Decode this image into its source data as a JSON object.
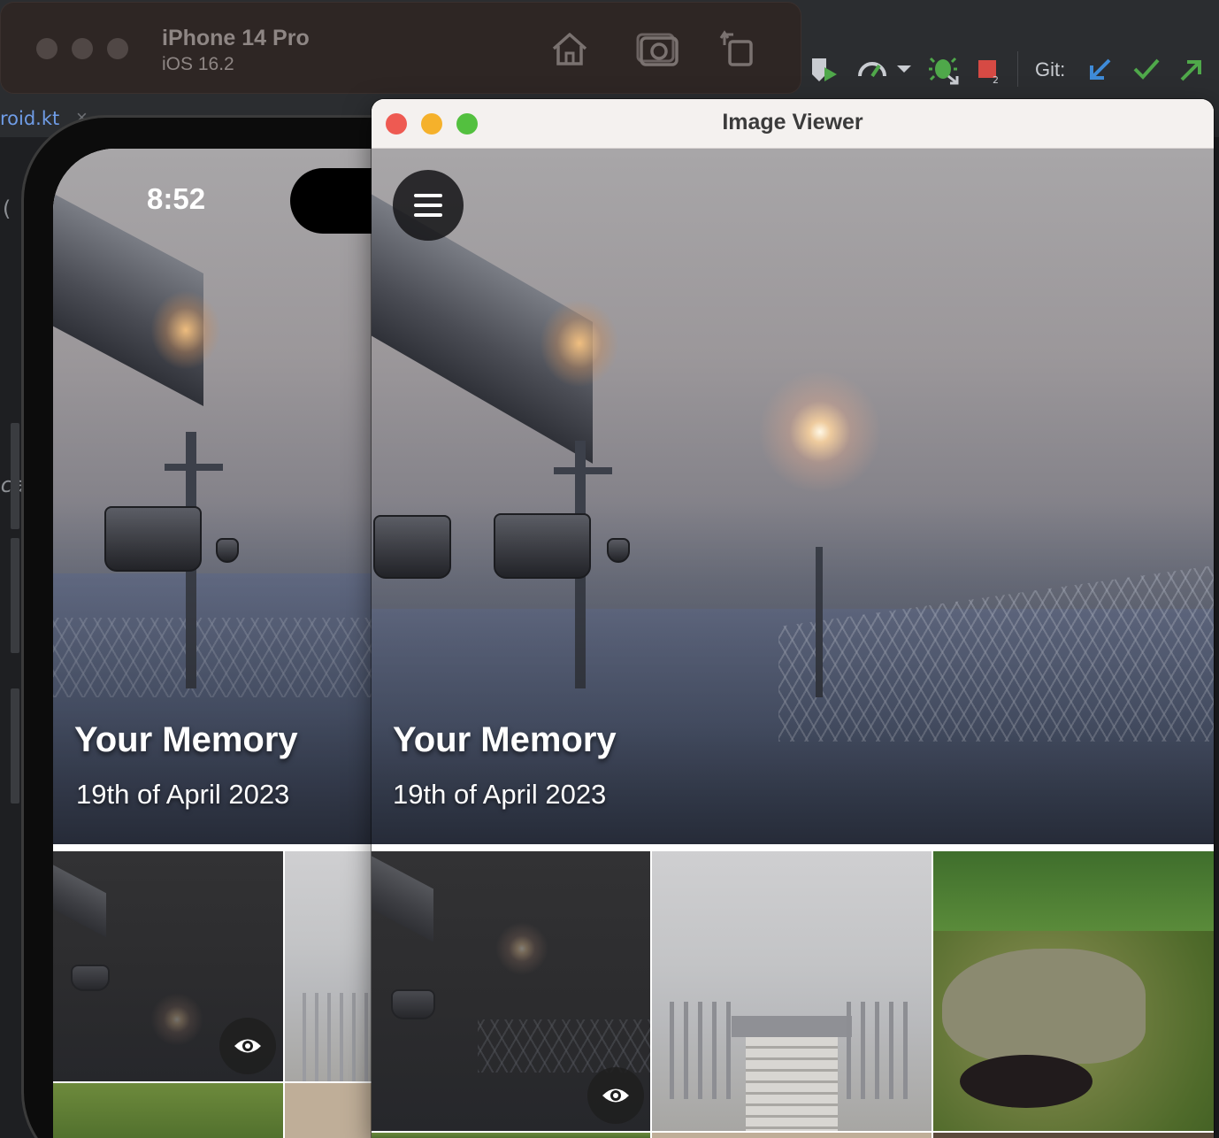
{
  "simulator": {
    "device_name": "iPhone 14 Pro",
    "os_version": "iOS 16.2",
    "icons": [
      "home-icon",
      "screenshot-icon",
      "rotate-icon"
    ]
  },
  "ide": {
    "tab_label": "roid.kt",
    "fragments": [
      "(",
      "ca"
    ],
    "git_label": "Git:",
    "toolbar_icons": [
      "coverage-icon",
      "profiler-icon",
      "attach-debugger-icon",
      "stop-icon",
      "git-update-icon",
      "git-commit-icon",
      "git-push-icon"
    ]
  },
  "phone": {
    "time": "8:52",
    "memory_title": "Your Memory",
    "memory_date": "19th of April 2023"
  },
  "viewer": {
    "window_title": "Image Viewer",
    "memory_title": "Your Memory",
    "memory_date": "19th of April 2023"
  },
  "colors": {
    "close": "#ee5a52",
    "minimize": "#f5b12b",
    "zoom": "#53c03f",
    "git_update": "#3f8bd8",
    "git_commit": "#4fa84a",
    "git_push": "#4fa84a"
  }
}
